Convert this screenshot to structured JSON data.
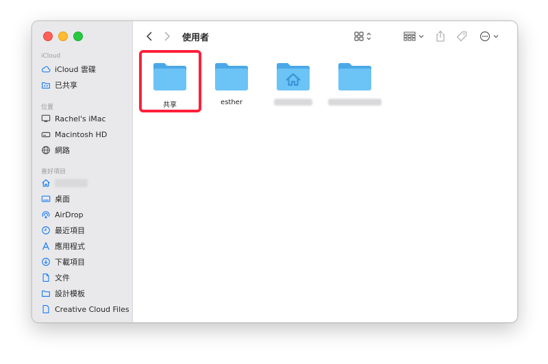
{
  "sidebar": {
    "sections": [
      {
        "title": "iCloud",
        "items": [
          {
            "label": "iCloud 雲碟",
            "icon": "cloud-icon"
          },
          {
            "label": "已共享",
            "icon": "shared-folder-icon"
          }
        ]
      },
      {
        "title": "位置",
        "items": [
          {
            "label": "Rachel's iMac",
            "icon": "imac-icon"
          },
          {
            "label": "Macintosh HD",
            "icon": "disk-icon"
          },
          {
            "label": "網路",
            "icon": "globe-icon"
          }
        ]
      },
      {
        "title": "喜好項目",
        "items": [
          {
            "label": "",
            "icon": "home-icon"
          },
          {
            "label": "桌面",
            "icon": "desktop-icon"
          },
          {
            "label": "AirDrop",
            "icon": "airdrop-icon"
          },
          {
            "label": "最近項目",
            "icon": "clock-icon"
          },
          {
            "label": "應用程式",
            "icon": "apps-icon"
          },
          {
            "label": "下載項目",
            "icon": "download-icon"
          },
          {
            "label": "文件",
            "icon": "document-icon"
          },
          {
            "label": "設計模板",
            "icon": "folder-icon"
          },
          {
            "label": "Creative Cloud Files",
            "icon": "file-icon"
          }
        ]
      }
    ]
  },
  "toolbar": {
    "title": "使用者"
  },
  "files": [
    {
      "label": "共享",
      "highlighted": true
    },
    {
      "label": "esther",
      "highlighted": false
    },
    {
      "label": "",
      "home": true
    },
    {
      "label": ""
    }
  ],
  "colors": {
    "accent": "#1a7ef5",
    "folder": "#6cc3f5",
    "highlight": "#ff1f3a"
  }
}
